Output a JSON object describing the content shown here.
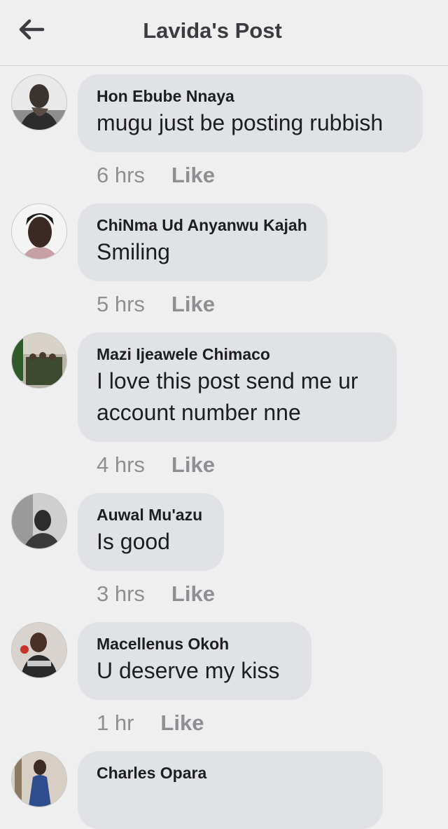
{
  "header": {
    "title": "Lavida's Post",
    "back_icon": "arrow-left-icon"
  },
  "comments": [
    {
      "name": "Hon Ebube Nnaya",
      "text_lines": [
        "mugu just be posting rubbish"
      ],
      "time": "6 hrs",
      "like": "Like"
    },
    {
      "name": "ChiNma Ud Anyanwu Kajah",
      "text_lines": [
        "Smiling"
      ],
      "time": "5 hrs",
      "like": "Like"
    },
    {
      "name": "Mazi Ijeawele Chimaco",
      "text_lines": [
        "I love this post  send me ur",
        "account number nne"
      ],
      "time": "4 hrs",
      "like": "Like"
    },
    {
      "name": "Auwal Mu'azu",
      "text_lines": [
        "Is good"
      ],
      "time": "3 hrs",
      "like": "Like"
    },
    {
      "name": "Macellenus Okoh",
      "text_lines": [
        "U deserve  my kiss"
      ],
      "time": "1 hr",
      "like": "Like"
    },
    {
      "name": "Charles Opara",
      "text_lines": [],
      "time": "",
      "like": ""
    }
  ],
  "colors": {
    "background": "#efefef",
    "bubble": "#e1e2e6",
    "text": "#1c1e21",
    "meta": "#8d8f93"
  }
}
